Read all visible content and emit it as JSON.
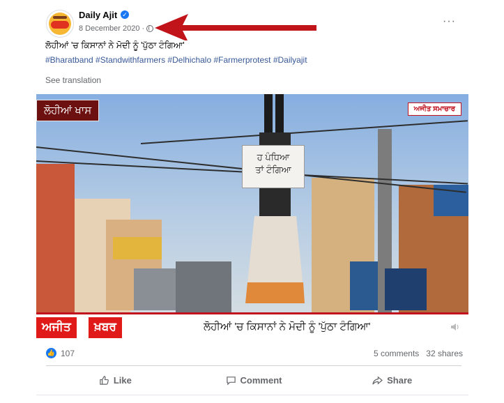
{
  "post": {
    "page_name": "Daily Ajit",
    "date": "8 December 2020",
    "separator": "·",
    "caption": "ਲੋਹੀਆਂ 'ਚ ਕਿਸਾਨਾਂ ਨੇ ਮੋਦੀ ਨੂੰ 'ਪੁੱਠਾ ਟੰਗਿਆ'",
    "hashtags": "#Bharatband #Standwithfarmers #Delhichalo #Farmerprotest #Dailyajit",
    "see_translation": "See translation",
    "more_label": "···"
  },
  "media": {
    "top_left_tag": "ਲੋਹੀਆਂ ਖਾਸ",
    "top_right_tag": "ਅਜੀਤ ਸਮਾਚਾਰ",
    "sign_line1": "ਹ ਪੰਧਿਆ",
    "sign_line2": "ਤਾਂ ਟੰਗਿਆ",
    "ticker_logo_a": "ਅਜੀਤ",
    "ticker_logo_b": "ਖ਼ਬਰ",
    "ticker_text": "ਲੋਹੀਆਂ 'ਚ ਕਿਸਾਨਾਂ ਨੇ ਮੋਦੀ ਨੂੰ 'ਪੁੱਠਾ ਟੰਗਿਆ'"
  },
  "stats": {
    "likes": "107",
    "comments": "5 comments",
    "shares": "32 shares"
  },
  "actions": {
    "like": "Like",
    "comment": "Comment",
    "share": "Share"
  },
  "colors": {
    "accent": "#1877f2",
    "link": "#385898",
    "arrow": "#c0141a",
    "news_red": "#e01919"
  }
}
